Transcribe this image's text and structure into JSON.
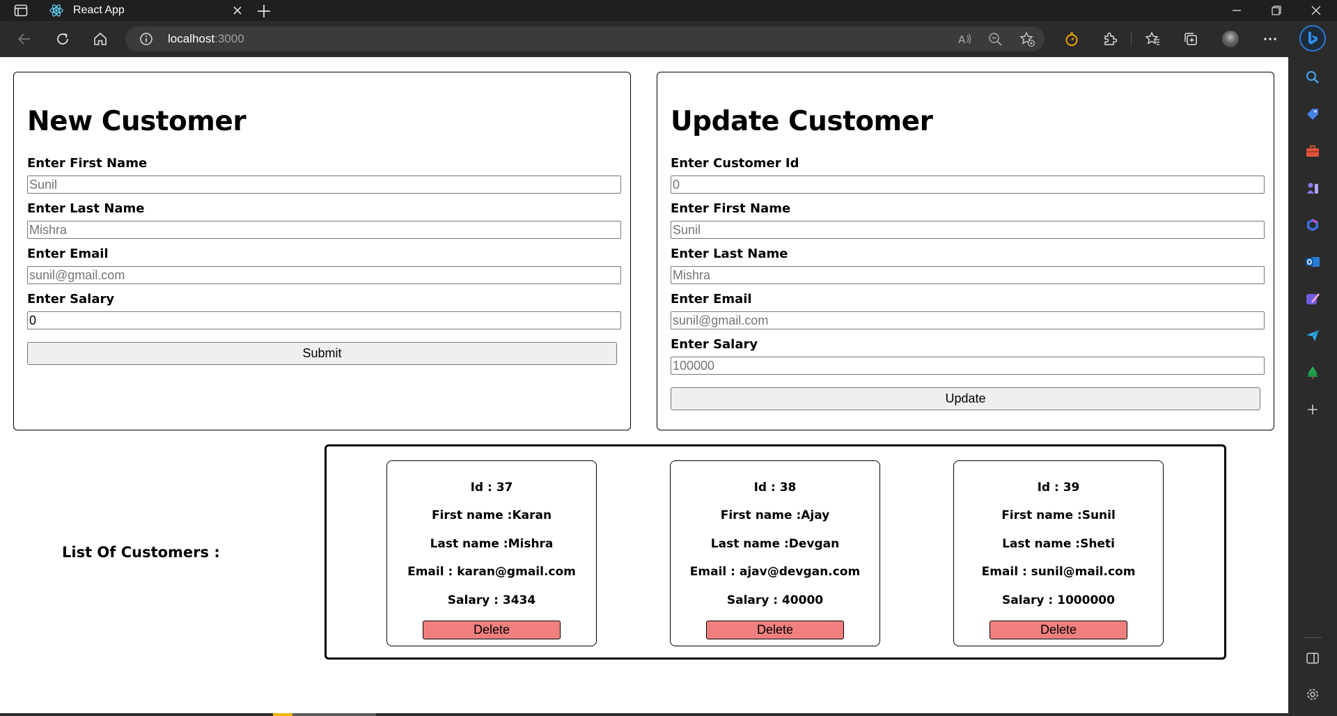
{
  "browser": {
    "tab_title": "React App",
    "url_host": "localhost",
    "url_port": ":3000"
  },
  "new_customer": {
    "heading": "New Customer",
    "fields": [
      {
        "label": "Enter First Name",
        "value": "",
        "placeholder": "Sunil"
      },
      {
        "label": "Enter Last Name",
        "value": "",
        "placeholder": "Mishra"
      },
      {
        "label": "Enter Email",
        "value": "",
        "placeholder": "sunil@gmail.com"
      },
      {
        "label": "Enter Salary",
        "value": "0",
        "placeholder": ""
      }
    ],
    "submit_label": "Submit"
  },
  "update_customer": {
    "heading": "Update Customer",
    "fields": [
      {
        "label": "Enter Customer Id",
        "value": "",
        "placeholder": "0"
      },
      {
        "label": "Enter First Name",
        "value": "",
        "placeholder": "Sunil"
      },
      {
        "label": "Enter Last Name",
        "value": "",
        "placeholder": "Mishra"
      },
      {
        "label": "Enter Email",
        "value": "",
        "placeholder": "sunil@gmail.com"
      },
      {
        "label": "Enter Salary",
        "value": "",
        "placeholder": "100000"
      }
    ],
    "update_label": "Update"
  },
  "customers": {
    "label": "List Of Customers :",
    "delete_label": "Delete",
    "items": [
      {
        "id": "Id : 37",
        "first": "First name :Karan",
        "last": "Last name :Mishra",
        "email": "Email : karan@gmail.com",
        "salary": "Salary : 3434"
      },
      {
        "id": "Id : 38",
        "first": "First name :Ajay",
        "last": "Last name :Devgan",
        "email": "Email : ajav@devgan.com",
        "salary": "Salary : 40000"
      },
      {
        "id": "Id : 39",
        "first": "First name :Sunil",
        "last": "Last name :Sheti",
        "email": "Email : sunil@mail.com",
        "salary": "Salary : 1000000"
      }
    ]
  },
  "colors": {
    "chrome_dark": "#1f1f1f",
    "toolbar": "#2b2b2b",
    "delete_button": "#f08080",
    "button_gray": "#efefef"
  },
  "icons": {
    "tab_actions": "tab-actions-icon",
    "favicon": "react-logo-icon",
    "back": "back-arrow-icon",
    "refresh": "refresh-icon",
    "home": "home-icon",
    "info": "info-icon",
    "read_aloud": "read-aloud-icon",
    "zoom": "zoom-out-icon",
    "add_favorite": "add-favorite-icon",
    "sidebar_search": "search-icon"
  }
}
